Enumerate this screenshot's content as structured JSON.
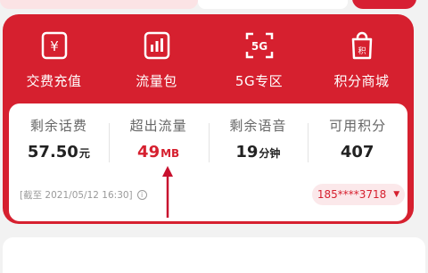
{
  "quick_menu": [
    {
      "label": "交费充值",
      "icon": "yuan-card-icon"
    },
    {
      "label": "流量包",
      "icon": "data-chart-icon"
    },
    {
      "label": "5G专区",
      "icon": "5g-icon"
    },
    {
      "label": "积分商城",
      "icon": "shopping-bag-icon"
    }
  ],
  "stats": [
    {
      "label": "剩余话费",
      "value": "57.50",
      "unit": "元"
    },
    {
      "label": "超出流量",
      "value": "49",
      "unit": "MB"
    },
    {
      "label": "剩余语音",
      "value": "19",
      "unit": "分钟"
    },
    {
      "label": "可用积分",
      "value": "407",
      "unit": ""
    }
  ],
  "as_of": "[截至 2021/05/12 16:30]",
  "info_icon_glyph": "i",
  "phone": "185****3718",
  "phone_caret": "▼",
  "icon_glyphs": {
    "yuan": "¥",
    "fiveg": "5G",
    "bag": "积"
  },
  "colors": {
    "brand_red": "#d6202f",
    "panel_bg": "#ffffff"
  }
}
